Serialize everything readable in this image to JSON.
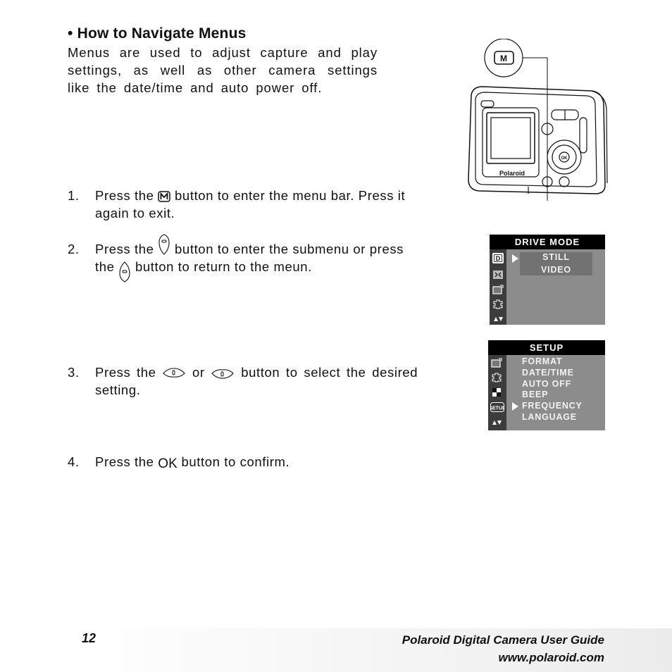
{
  "section": {
    "heading": "• How to Navigate Menus",
    "intro": "Menus are used to adjust capture and play settings, as well as other camera settings like the date/time and auto power off."
  },
  "steps": [
    {
      "num": "1.",
      "parts": [
        "Press the",
        "button to enter the menu bar. Press it",
        "again to exit."
      ],
      "icon": "m-button-icon"
    },
    {
      "num": "2.",
      "parts": [
        "Press the",
        "button to enter the submenu or press",
        "the",
        "button to return to the meun."
      ],
      "icons": [
        "right-button-icon",
        "left-button-icon"
      ]
    },
    {
      "num": "3.",
      "parts": [
        "Press the",
        "or",
        "button to select the desired",
        "setting."
      ],
      "icons": [
        "up-button-icon",
        "down-button-icon"
      ]
    },
    {
      "num": "4.",
      "parts": [
        "Press the",
        "OK",
        "button to confirm."
      ]
    }
  ],
  "camera_callout": {
    "label": "M"
  },
  "camera": {
    "brand": "Polaroid"
  },
  "drive_mode_screen": {
    "title": "DRIVE MODE",
    "items": [
      "STILL",
      "VIDEO"
    ],
    "selected": "STILL",
    "side_icons": [
      "drive-mode-icon",
      "resolution-icon",
      "setup-card-icon",
      "frame-icon",
      "scroll-arrows-icon"
    ]
  },
  "setup_screen": {
    "title": "SETUP",
    "items": [
      "FORMAT",
      "DATE/TIME",
      "AUTO OFF",
      "BEEP",
      "FREQUENCY",
      "LANGUAGE"
    ],
    "selected": "FREQUENCY",
    "side_icons": [
      "setup-card-icon",
      "frame-icon",
      "checker-icon",
      "setup-icon",
      "scroll-arrows-icon"
    ],
    "setup_icon_label": "SETUP"
  },
  "footer": {
    "page_number": "12",
    "title": "Polaroid Digital Camera User Guide",
    "url": "www.polaroid.com"
  }
}
